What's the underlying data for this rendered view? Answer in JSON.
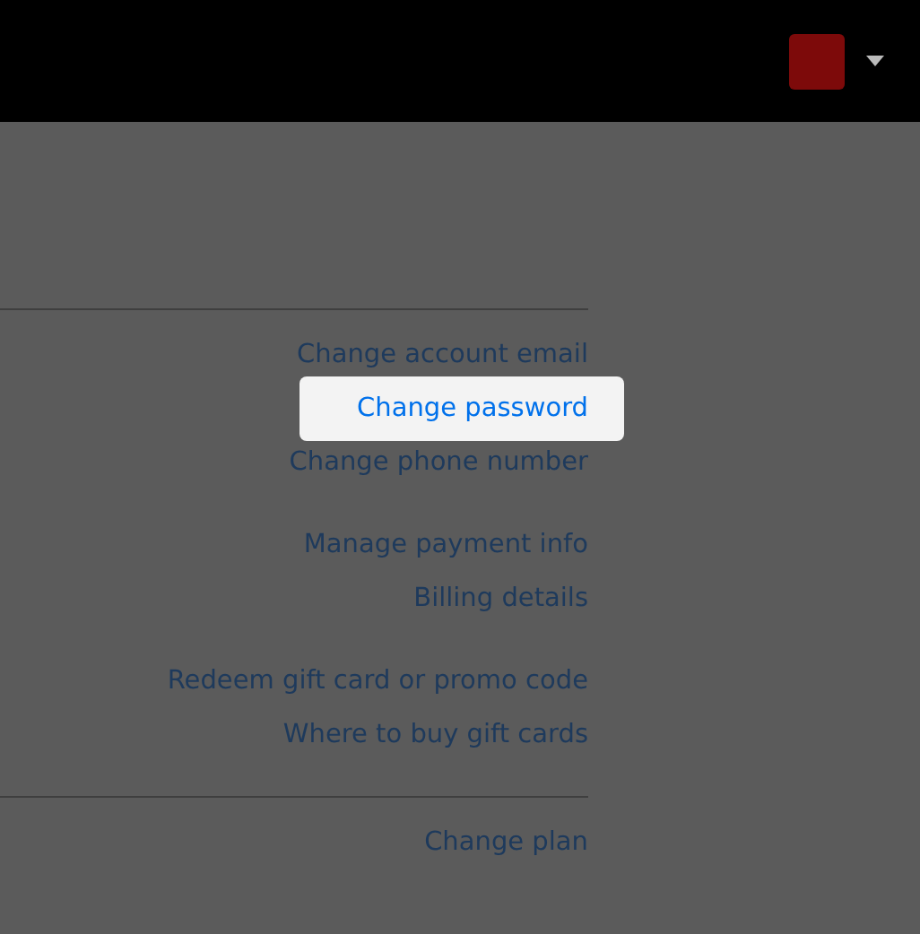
{
  "header": {
    "profile_menu": {
      "expanded": false
    }
  },
  "sections": [
    {
      "groups": [
        {
          "links": [
            {
              "label": "Change account email",
              "selected": false
            },
            {
              "label": "Change password",
              "selected": true
            },
            {
              "label": "Change phone number",
              "selected": false
            }
          ]
        },
        {
          "links": [
            {
              "label": "Manage payment info",
              "selected": false
            },
            {
              "label": "Billing details",
              "selected": false
            }
          ]
        },
        {
          "links": [
            {
              "label": "Redeem gift card or promo code",
              "selected": false
            },
            {
              "label": "Where to buy gift cards",
              "selected": false
            }
          ]
        }
      ]
    },
    {
      "groups": [
        {
          "links": [
            {
              "label": "Change plan",
              "selected": false
            }
          ]
        }
      ]
    }
  ]
}
